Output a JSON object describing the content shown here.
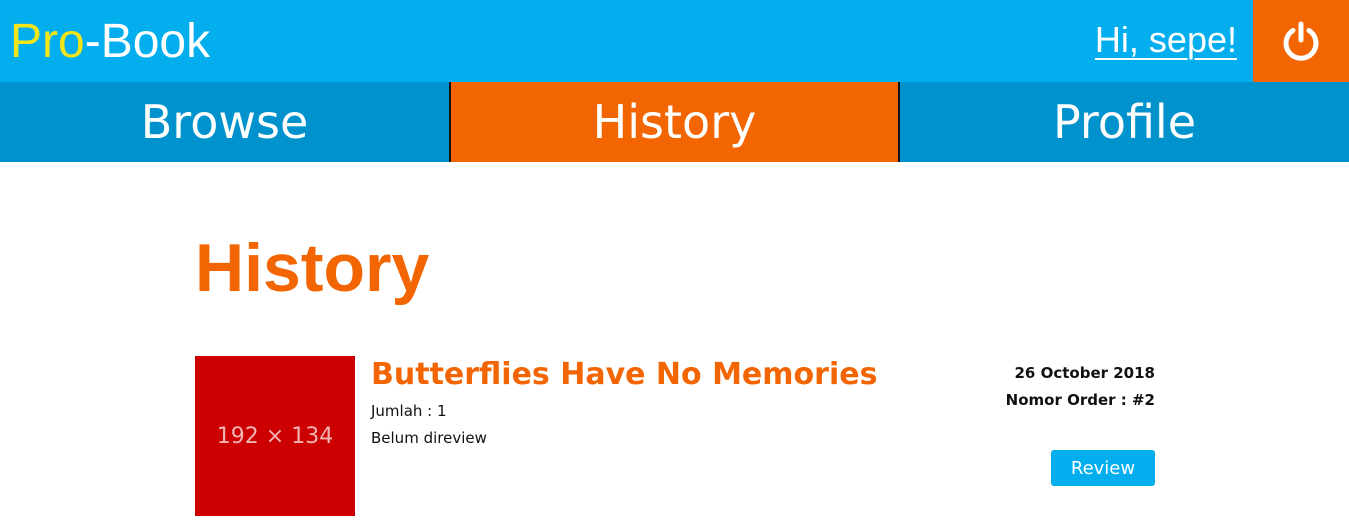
{
  "header": {
    "brand_prefix": "Pro",
    "brand_suffix": "-Book",
    "greeting": "Hi, sepe!",
    "logout_icon": "power-icon",
    "colors": {
      "topbar": "#03aeef",
      "brand_accent": "#f2e51a",
      "logout": "#f26500"
    }
  },
  "nav": {
    "tabs": [
      {
        "label": "Browse",
        "active": false
      },
      {
        "label": "History",
        "active": true
      },
      {
        "label": "Profile",
        "active": false
      }
    ],
    "colors": {
      "bar": "#0092cc",
      "active": "#f26500"
    }
  },
  "main": {
    "title": "History",
    "orders": [
      {
        "cover_placeholder": "192 × 134",
        "title": "Butterflies Have No Memories",
        "quantity": "Jumlah : 1",
        "review_status": "Belum direview",
        "date": "26 October 2018",
        "order_number": "Nomor Order : #2",
        "review_button": "Review"
      }
    ]
  }
}
